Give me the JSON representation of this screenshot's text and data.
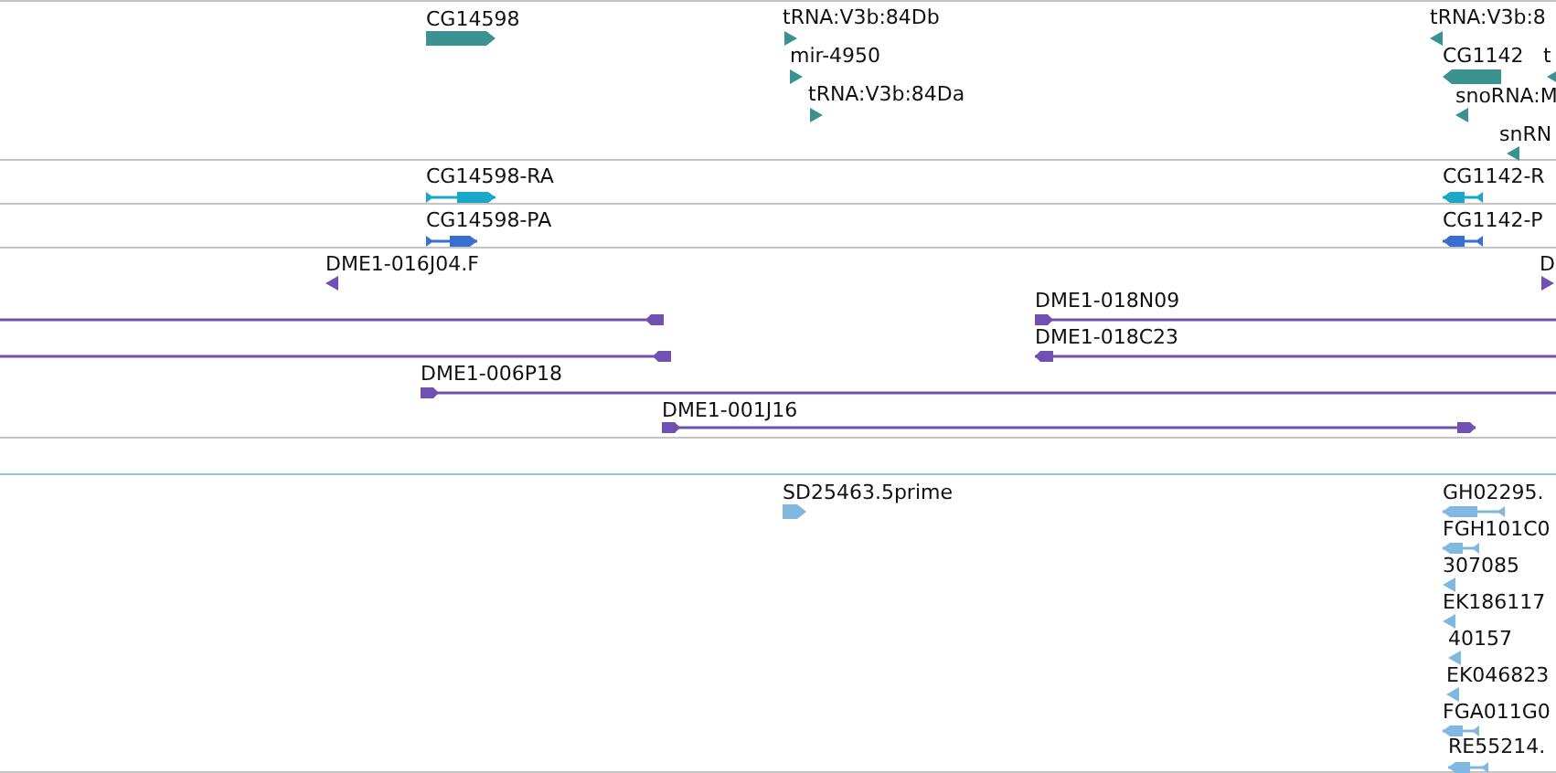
{
  "tracks": [
    {
      "color": "#3c9191",
      "features": [
        {
          "label": "CG14598",
          "kind": "block",
          "reverse": false
        },
        {
          "label": "tRNA:V3b:84Db",
          "kind": "tick",
          "reverse": false
        },
        {
          "label": "mir-4950",
          "kind": "tick",
          "reverse": false
        },
        {
          "label": "tRNA:V3b:84Da",
          "kind": "tick",
          "reverse": false
        },
        {
          "label": "tRNA:V3b:8",
          "kind": "tick",
          "reverse": true
        },
        {
          "label": "CG1142",
          "kind": "block",
          "reverse": true
        },
        {
          "label": "t",
          "kind": "tick",
          "reverse": true
        },
        {
          "label": "snoRNA:M",
          "kind": "tick",
          "reverse": true
        },
        {
          "label": "snRN",
          "kind": "tick",
          "reverse": true
        }
      ]
    },
    {
      "color": "#1ba8c8",
      "features": [
        {
          "label": "CG14598-RA",
          "kind": "transcript",
          "reverse": false
        },
        {
          "label": "CG1142-R",
          "kind": "transcript",
          "reverse": true
        }
      ]
    },
    {
      "color": "#3a6fd0",
      "features": [
        {
          "label": "CG14598-PA",
          "kind": "transcript",
          "reverse": false
        },
        {
          "label": "CG1142-P",
          "kind": "transcript",
          "reverse": true
        }
      ]
    },
    {
      "color": "#7050b0",
      "features": [
        {
          "label": "DME1-016J04.F",
          "kind": "tick",
          "reverse": true
        },
        {
          "kind": "span",
          "reverse": true
        },
        {
          "kind": "span",
          "reverse": true
        },
        {
          "label": "DME1-018N09",
          "kind": "span",
          "reverse": false
        },
        {
          "label": "DME1-018C23",
          "kind": "span",
          "reverse": true
        },
        {
          "label": "DME1-006P18",
          "kind": "span",
          "reverse": false
        },
        {
          "label": "DME1-001J16",
          "kind": "span",
          "reverse": false
        },
        {
          "label": "D",
          "kind": "tick",
          "reverse": false
        }
      ]
    },
    {
      "color": "#80b8e0",
      "features": [
        {
          "label": "SD25463.5prime",
          "kind": "block",
          "reverse": false
        },
        {
          "label": "GH02295.",
          "kind": "transcript",
          "reverse": true
        },
        {
          "label": "FGH101C0",
          "kind": "transcript",
          "reverse": true
        },
        {
          "label": "307085",
          "kind": "tick",
          "reverse": true
        },
        {
          "label": "EK186117",
          "kind": "tick",
          "reverse": true
        },
        {
          "label": "40157",
          "kind": "tick",
          "reverse": true
        },
        {
          "label": "EK046823",
          "kind": "tick",
          "reverse": true
        },
        {
          "label": "FGA011G0",
          "kind": "transcript",
          "reverse": true
        },
        {
          "label": "RE55214.",
          "kind": "transcript",
          "reverse": true
        }
      ]
    }
  ]
}
